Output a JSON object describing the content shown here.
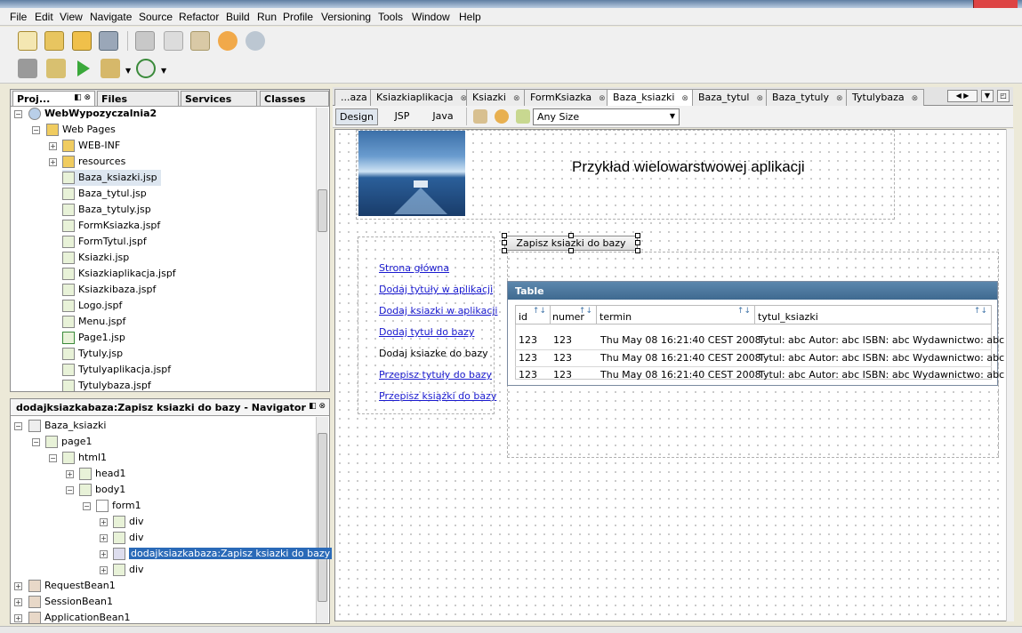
{
  "menu": [
    "File",
    "Edit",
    "View",
    "Navigate",
    "Source",
    "Refactor",
    "Build",
    "Run",
    "Profile",
    "Versioning",
    "Tools",
    "Window",
    "Help"
  ],
  "projects_panel": {
    "tabs": [
      "Proj...",
      "Files",
      "Services",
      "Classes"
    ],
    "tree": {
      "project": "WebWypozyczalnia2",
      "web_pages": "Web Pages",
      "items": [
        "WEB-INF",
        "resources",
        "Baza_ksiazki.jsp",
        "Baza_tytul.jsp",
        "Baza_tytuly.jsp",
        "FormKsiazka.jspf",
        "FormTytul.jspf",
        "Ksiazki.jsp",
        "Ksiazkiaplikacja.jspf",
        "Ksiazkibaza.jspf",
        "Logo.jspf",
        "Menu.jspf",
        "Page1.jsp",
        "Tytuly.jsp",
        "Tytulyaplikacja.jspf",
        "Tytulybaza.jspf"
      ]
    }
  },
  "navigator": {
    "title": "dodajksiazkabaza:Zapisz ksiazki do bazy - Navigator",
    "items": [
      "Baza_ksiazki",
      "page1",
      "html1",
      "head1",
      "body1",
      "form1",
      "div",
      "div",
      "dodajksiazkabaza:Zapisz ksiazki do bazy",
      "div",
      "RequestBean1",
      "SessionBean1",
      "ApplicationBean1"
    ]
  },
  "editor_tabs": [
    "...aza",
    "Ksiazkiaplikacja",
    "Ksiazki",
    "FormKsiazka",
    "Baza_ksiazki",
    "Baza_tytul",
    "Baza_tytuly",
    "Tytulybaza"
  ],
  "active_tab": "Baza_ksiazki",
  "subbar": {
    "design": "Design",
    "jsp": "JSP",
    "java": "Java",
    "size_select": "Any Size"
  },
  "page": {
    "heading": "Przykład wielowarstwowej aplikacji",
    "button": "Zapisz ksiazki do bazy",
    "menu_links": [
      "Strona główna",
      "Dodaj tytuły w aplikacji",
      "Dodaj ksiazki w aplikacji",
      "Dodaj tytuł do bazy",
      "Dodaj ksiazke do bazy",
      "Przepisz tytuły do bazy",
      "Przepisz książki do bazy"
    ],
    "table": {
      "title": "Table",
      "columns": [
        "id",
        "numer",
        "termin",
        "tytul_ksiazki"
      ],
      "rows": [
        [
          "123",
          "123",
          "Thu May 08 16:21:40 CEST 2008",
          "Tytul: abc Autor: abc ISBN: abc Wydawnictwo: abc"
        ],
        [
          "123",
          "123",
          "Thu May 08 16:21:40 CEST 2008",
          "Tytul: abc Autor: abc ISBN: abc Wydawnictwo: abc"
        ],
        [
          "123",
          "123",
          "Thu May 08 16:21:40 CEST 2008",
          "Tytul: abc Autor: abc ISBN: abc Wydawnictwo: abc"
        ]
      ]
    }
  }
}
